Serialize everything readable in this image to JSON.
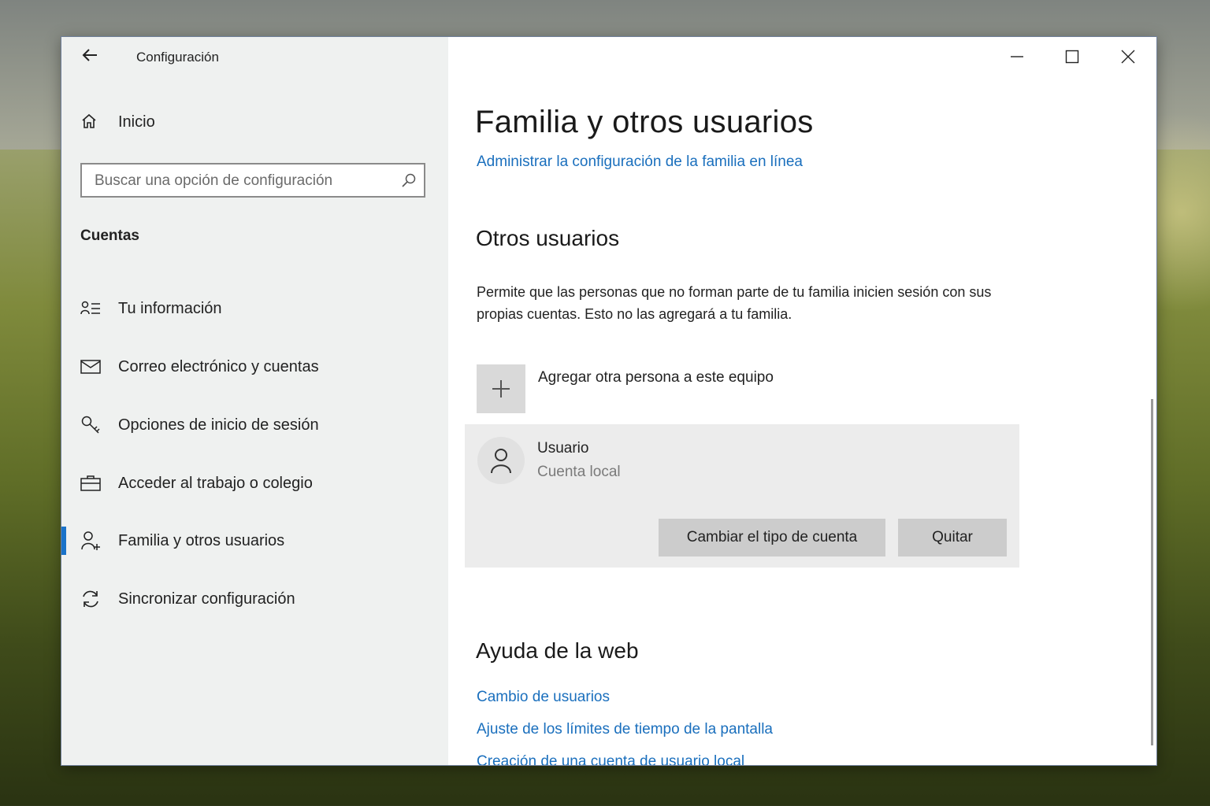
{
  "window": {
    "title": "Configuración",
    "back_icon": "arrow-left-icon"
  },
  "sidebar": {
    "home_label": "Inicio",
    "search_placeholder": "Buscar una opción de configuración",
    "section_label": "Cuentas",
    "items": [
      {
        "label": "Tu información",
        "icon": "person-info-icon",
        "active": false
      },
      {
        "label": "Correo electrónico y cuentas",
        "icon": "mail-icon",
        "active": false
      },
      {
        "label": "Opciones de inicio de sesión",
        "icon": "key-icon",
        "active": false
      },
      {
        "label": "Acceder al trabajo o colegio",
        "icon": "briefcase-icon",
        "active": false
      },
      {
        "label": "Familia y otros usuarios",
        "icon": "person-add-icon",
        "active": true
      },
      {
        "label": "Sincronizar configuración",
        "icon": "sync-icon",
        "active": false
      }
    ]
  },
  "main": {
    "title": "Familia y otros usuarios",
    "family_link": "Administrar la configuración de la familia en línea",
    "other_users_heading": "Otros usuarios",
    "other_users_desc": "Permite que las personas que no forman parte de tu familia inicien sesión con sus propias cuentas. Esto no las agregará a tu familia.",
    "add_person_label": "Agregar otra persona a este equipo",
    "user": {
      "name": "Usuario",
      "account_type": "Cuenta local",
      "change_type_button": "Cambiar el tipo de cuenta",
      "remove_button": "Quitar"
    },
    "web_help_heading": "Ayuda de la web",
    "web_help_links": [
      "Cambio de usuarios",
      "Ajuste de los límites de tiempo de la pantalla",
      "Creación de una cuenta de usuario local"
    ]
  },
  "colors": {
    "accent": "#1a73c9",
    "link": "#1a6fbd",
    "sidebar_bg": "#eff1f0"
  }
}
